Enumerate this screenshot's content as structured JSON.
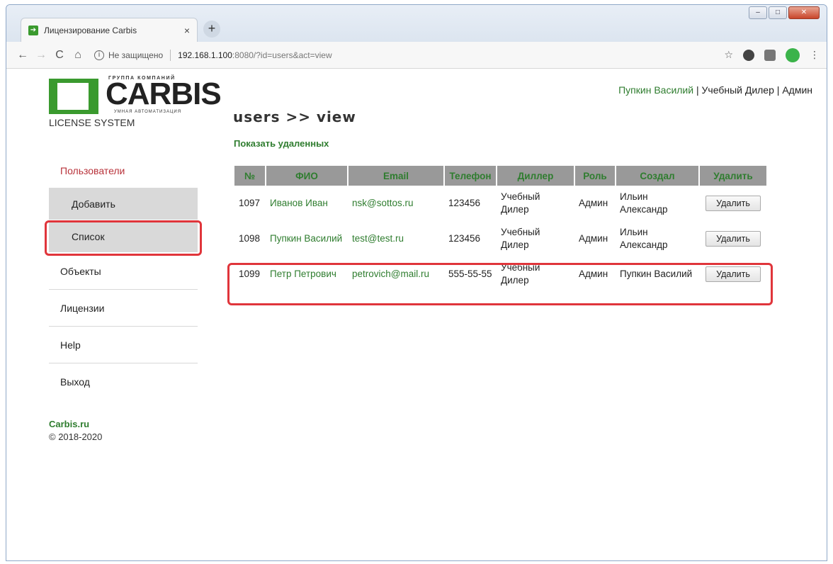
{
  "browser": {
    "tab_title": "Лицензирование Carbis",
    "tab_close": "×",
    "new_tab": "+",
    "back": "←",
    "forward": "→",
    "reload": "C",
    "home": "⌂",
    "info": "i",
    "security": "Не защищено",
    "url_host": "192.168.1.100",
    "url_rest": ":8080/?id=users&act=view",
    "star": "☆",
    "menu": "⋮"
  },
  "logo": {
    "group": "ГРУППА КОМПАНИЙ",
    "word": "CARBIS",
    "tag": "УМНАЯ АВТОМАТИЗАЦИЯ",
    "license": "LICENSE SYSTEM"
  },
  "userbar": {
    "name": "Пупкин Василий",
    "sep1": " | ",
    "role1": "Учебный Дилер",
    "sep2": " | ",
    "role2": "Админ"
  },
  "page": {
    "heading": "users >> view",
    "show_deleted": "Показать удаленных"
  },
  "sidebar": {
    "users": "Пользователи",
    "add": "Добавить",
    "list": "Список",
    "objects": "Объекты",
    "licenses": "Лицензии",
    "help": "Help",
    "logout": "Выход"
  },
  "footer": {
    "link": "Carbis.ru",
    "copyright": "© 2018-2020"
  },
  "table": {
    "headers": [
      "№",
      "ФИО",
      "Email",
      "Телефон",
      "Диллер",
      "Роль",
      "Создал",
      "Удалить"
    ],
    "rows": [
      {
        "id": "1097",
        "name": "Иванов Иван",
        "email": "nsk@sottos.ru",
        "phone": "123456",
        "dealer": "Учебный Дилер",
        "role": "Админ",
        "created": "Ильин Александр",
        "delete": "Удалить"
      },
      {
        "id": "1098",
        "name": "Пупкин Василий",
        "email": "test@test.ru",
        "phone": "123456",
        "dealer": "Учебный Дилер",
        "role": "Админ",
        "created": "Ильин Александр",
        "delete": "Удалить"
      },
      {
        "id": "1099",
        "name": "Петр Петрович",
        "email": "petrovich@mail.ru",
        "phone": "555-55-55",
        "dealer": "Учебный Дилер",
        "role": "Админ",
        "created": "Пупкин Василий",
        "delete": "Удалить"
      }
    ]
  }
}
